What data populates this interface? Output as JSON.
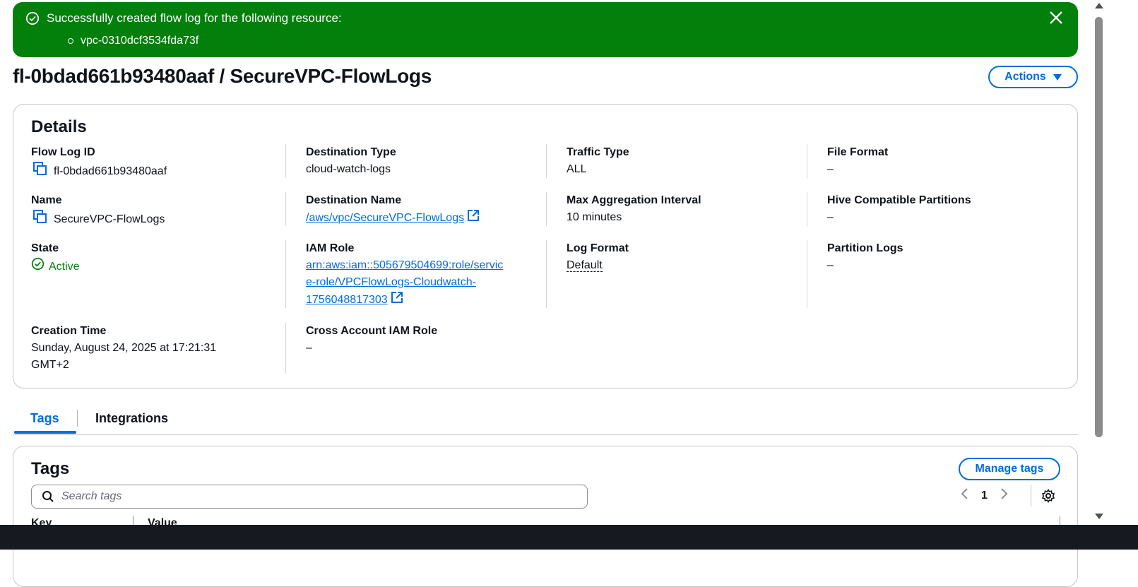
{
  "flash": {
    "title": "Successfully created flow log for the following resource:",
    "resource": "vpc-0310dcf3534fda73f",
    "color": "#037f0c"
  },
  "header": {
    "title": "fl-0bdad661b93480aaf / SecureVPC-FlowLogs",
    "actions_label": "Actions"
  },
  "details": {
    "heading": "Details",
    "flow_log_id": {
      "label": "Flow Log ID",
      "value": "fl-0bdad661b93480aaf"
    },
    "name": {
      "label": "Name",
      "value": "SecureVPC-FlowLogs"
    },
    "state": {
      "label": "State",
      "value": "Active"
    },
    "creation_time": {
      "label": "Creation Time",
      "value_line1": "Sunday, August 24, 2025 at 17:21:31",
      "value_line2": "GMT+2"
    },
    "destination_type": {
      "label": "Destination Type",
      "value": "cloud-watch-logs"
    },
    "destination_name": {
      "label": "Destination Name",
      "value": "/aws/vpc/SecureVPC-FlowLogs"
    },
    "iam_role": {
      "label": "IAM Role",
      "line1": "arn:aws:iam::505679504699:role/servic",
      "line2": "e-role/VPCFlowLogs-Cloudwatch-",
      "line3": "1756048817303"
    },
    "cross_account_iam_role": {
      "label": "Cross Account IAM Role",
      "value": "–"
    },
    "traffic_type": {
      "label": "Traffic Type",
      "value": "ALL"
    },
    "max_aggregation_interval": {
      "label": "Max Aggregation Interval",
      "value": "10 minutes"
    },
    "log_format": {
      "label": "Log Format",
      "value": "Default"
    },
    "file_format": {
      "label": "File Format",
      "value": "–"
    },
    "hive_compatible_partitions": {
      "label": "Hive Compatible Partitions",
      "value": "–"
    },
    "partition_logs": {
      "label": "Partition Logs",
      "value": "–"
    }
  },
  "tabs": [
    {
      "label": "Tags",
      "active": true
    },
    {
      "label": "Integrations",
      "active": false
    }
  ],
  "tags_panel": {
    "heading": "Tags",
    "manage_label": "Manage tags",
    "search_placeholder": "Search tags",
    "page": "1",
    "columns": [
      "Key",
      "Value"
    ]
  },
  "colors": {
    "accent": "#006ce0",
    "success": "#037f0c",
    "text": "#0f141a"
  },
  "icons": [
    "check-circle-icon",
    "close-icon",
    "caret-down-icon",
    "copy-icon",
    "external-link-icon",
    "search-icon",
    "chevron-left-icon",
    "chevron-right-icon",
    "gear-icon"
  ]
}
